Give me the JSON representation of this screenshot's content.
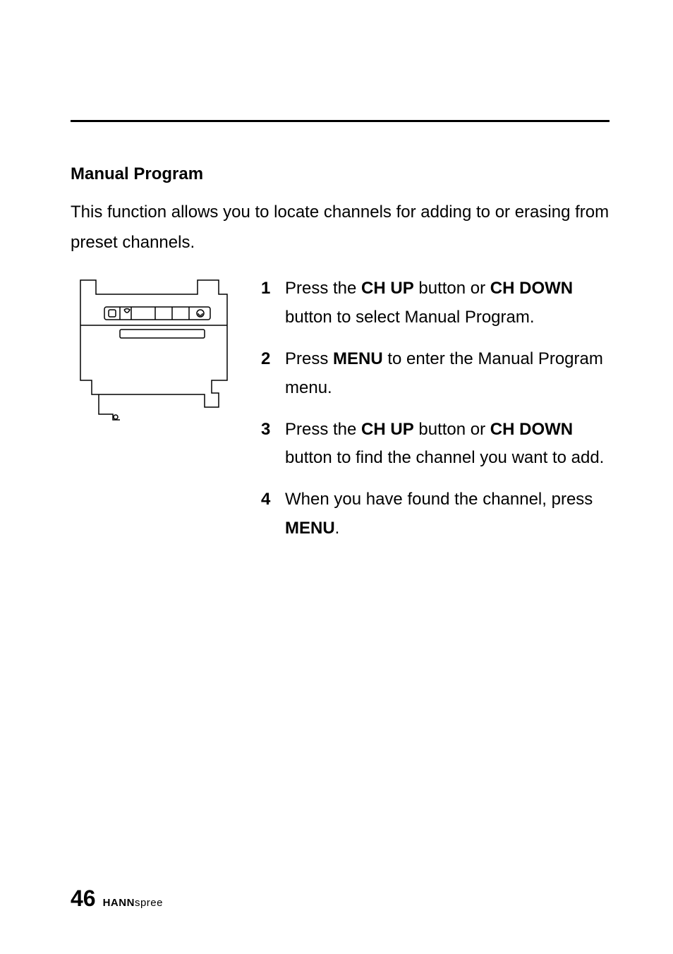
{
  "section": {
    "title": "Manual Program",
    "intro": "This function allows you to locate channels for adding to or erasing from preset channels."
  },
  "steps": [
    {
      "num": "1",
      "parts": [
        {
          "t": "Press the ",
          "b": false
        },
        {
          "t": "CH UP",
          "b": true
        },
        {
          "t": " button or ",
          "b": false
        },
        {
          "t": "CH DOWN",
          "b": true
        },
        {
          "t": " button to select Manual Program.",
          "b": false
        }
      ]
    },
    {
      "num": "2",
      "parts": [
        {
          "t": "Press ",
          "b": false
        },
        {
          "t": "MENU",
          "b": true
        },
        {
          "t": " to enter the Manual Program menu.",
          "b": false
        }
      ]
    },
    {
      "num": "3",
      "parts": [
        {
          "t": "Press the ",
          "b": false
        },
        {
          "t": "CH UP",
          "b": true
        },
        {
          "t": " button or ",
          "b": false
        },
        {
          "t": "CH DOWN",
          "b": true
        },
        {
          "t": " button to find the channel you want to add.",
          "b": false
        }
      ]
    },
    {
      "num": "4",
      "parts": [
        {
          "t": "When you have found the channel, press ",
          "b": false
        },
        {
          "t": "MENU",
          "b": true
        },
        {
          "t": ".",
          "b": false
        }
      ]
    }
  ],
  "footer": {
    "page_number": "46",
    "brand_bold": "HANN",
    "brand_light": "spree"
  }
}
